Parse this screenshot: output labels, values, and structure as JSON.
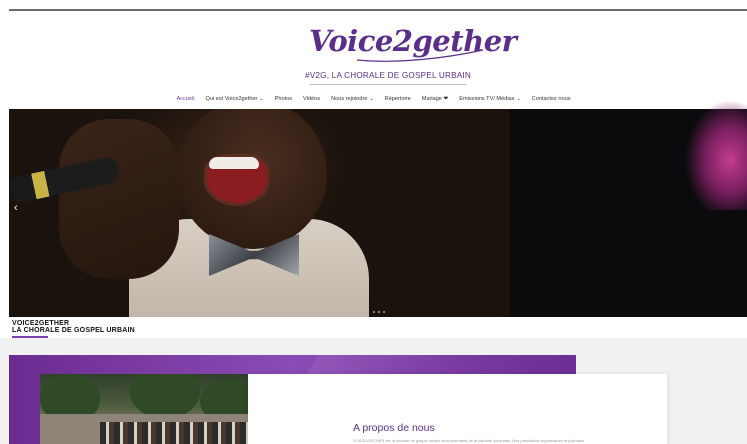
{
  "header": {
    "logo_text": "Voice2gether",
    "tagline": "#V2G, LA CHORALE DE GOSPEL URBAIN"
  },
  "nav": {
    "items": [
      {
        "label": "Accueil",
        "active": true,
        "dropdown": false
      },
      {
        "label": "Qui est Voice2gether",
        "active": false,
        "dropdown": true
      },
      {
        "label": "Photos",
        "active": false,
        "dropdown": false
      },
      {
        "label": "Vidéos",
        "active": false,
        "dropdown": false
      },
      {
        "label": "Nous rejoindre",
        "active": false,
        "dropdown": true
      },
      {
        "label": "Répertoire",
        "active": false,
        "dropdown": false
      },
      {
        "label": "Mariage ❤",
        "active": false,
        "dropdown": false
      },
      {
        "label": "Emissions TV/ Médias",
        "active": false,
        "dropdown": true
      },
      {
        "label": "Contactez nous",
        "active": false,
        "dropdown": false
      }
    ]
  },
  "hero": {
    "prev_arrow": "‹",
    "dots_count": 3,
    "caption_line1": "VOICE2GETHER",
    "caption_line2": "LA CHORALE DE GOSPEL URBAIN"
  },
  "about": {
    "title": "A propos de nous",
    "text": "VOICE2GETHER est la chorale de gospel urbain incontournable de la capitale lyonnaise. Nos prestations dynamiques et joyeuses"
  },
  "colors": {
    "brand_purple": "#5a2e8a",
    "panel_purple": "#7b3fa6",
    "accent": "#7a3fb0"
  }
}
